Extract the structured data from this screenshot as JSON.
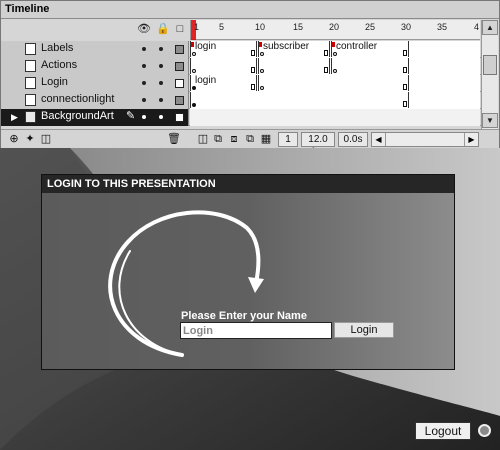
{
  "timeline": {
    "title": "Timeline",
    "header_icons": {
      "eye": "eye-icon",
      "lock": "lock-icon",
      "outline": "outline-square-icon"
    },
    "ruler_labels": [
      "1",
      "5",
      "10",
      "15",
      "20",
      "25",
      "30",
      "35",
      "4"
    ],
    "layers": [
      {
        "name": "Labels",
        "swatch": "#8c8c8c",
        "type": "layer",
        "selected": false,
        "blocks": [
          {
            "label": "login"
          },
          {
            "label": "subscriber"
          },
          {
            "label": "controller"
          }
        ]
      },
      {
        "name": "Actions",
        "swatch": "#8c8c8c",
        "type": "layer",
        "selected": false,
        "blocks": [
          {
            "label": ""
          },
          {
            "label": ""
          },
          {
            "label": ""
          }
        ]
      },
      {
        "name": "Login",
        "swatch": "#ffffff",
        "type": "layer",
        "selected": false,
        "blocks": [
          {
            "label": "login"
          },
          {
            "label": ""
          }
        ]
      },
      {
        "name": "connectionlight",
        "swatch": "#8c8c8c",
        "type": "layer",
        "selected": false,
        "blocks": [
          {
            "label": ""
          }
        ]
      },
      {
        "name": "BackgroundArt",
        "swatch": "#ffffff",
        "type": "folder",
        "selected": true,
        "blocks": []
      }
    ],
    "bottom": {
      "current_frame": "1",
      "fps": "12.0 fps",
      "elapsed": "0.0s"
    }
  },
  "stage": {
    "panel_title": "LOGIN TO THIS PRESENTATION",
    "prompt": "Please Enter your Name",
    "input_placeholder": "Login",
    "login_button": "Login",
    "logout_button": "Logout"
  }
}
